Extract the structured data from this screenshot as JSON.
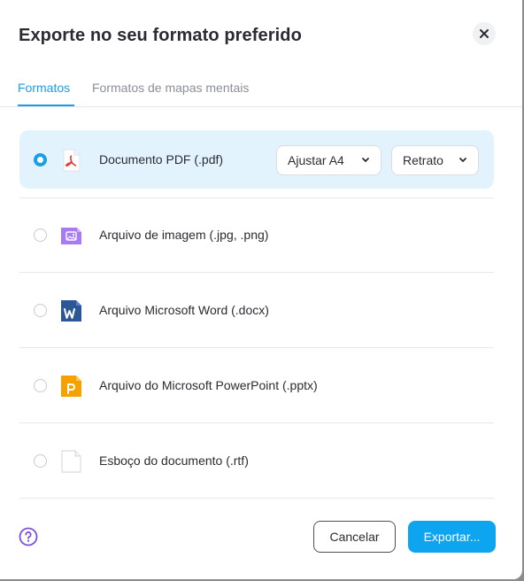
{
  "dialog": {
    "title": "Exporte no seu formato preferido",
    "close_icon": "close-icon"
  },
  "tabs": [
    {
      "label": "Formatos",
      "active": true
    },
    {
      "label": "Formatos de mapas mentais",
      "active": false
    }
  ],
  "formats": [
    {
      "label": "Documento PDF (.pdf)",
      "icon": "pdf-icon",
      "selected": true
    },
    {
      "label": "Arquivo de imagem (.jpg, .png)",
      "icon": "image-file-icon",
      "selected": false
    },
    {
      "label": "Arquivo Microsoft Word (.docx)",
      "icon": "word-icon",
      "selected": false
    },
    {
      "label": "Arquivo do Microsoft PowerPoint (.pptx)",
      "icon": "powerpoint-icon",
      "selected": false
    },
    {
      "label": "Esboço do documento (.rtf)",
      "icon": "blank-document-icon",
      "selected": false
    }
  ],
  "pdf_options": {
    "page_size": "Ajustar A4",
    "orientation": "Retrato"
  },
  "footer": {
    "help_icon": "help-icon",
    "cancel_label": "Cancelar",
    "export_label": "Exportar..."
  },
  "colors": {
    "accent": "#1a9fe6",
    "selected_row_bg": "#e3f3fd",
    "primary_button": "#0ea5f0",
    "help_icon": "#7b4fe0"
  }
}
